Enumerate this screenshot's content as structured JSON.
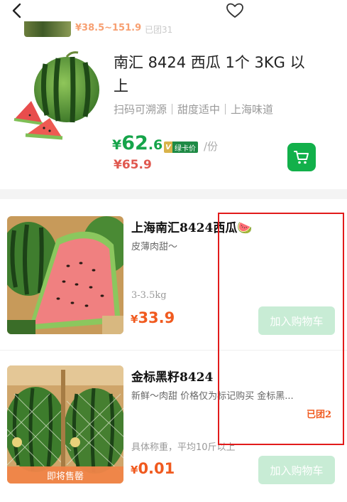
{
  "header": {
    "back_icon": "chevron-left-icon",
    "favorite_icon": "heart-outline-icon"
  },
  "partial_item": {
    "price_text": "¥38.5~151.9",
    "group_text": "已团31"
  },
  "featured_product": {
    "title": "南汇 8424 西瓜 1个 3KG 以上",
    "tags": "扫码可溯源｜甜度适中｜上海味道",
    "price_currency": "¥",
    "price_int": "62",
    "price_dec": ".6",
    "vip_letter": "V",
    "vip_label": "绿卡价",
    "unit": "/份",
    "original_price": "¥65.9",
    "cart_icon": "shopping-cart-icon"
  },
  "products": [
    {
      "title": "上海南汇8424西瓜",
      "emoji": "🍉",
      "subtitle": "皮薄肉甜～",
      "spec": "3-3.5kg",
      "price_currency": "¥",
      "price": "33.9",
      "add_label": "加入购物车"
    },
    {
      "title": "金标黑籽8424",
      "subtitle": "新鲜～肉甜 价格仅为标记购买 金标黑...",
      "group_count": "已团2",
      "spec": "具体称重，平均10斤以上",
      "price_currency": "¥",
      "price": "0.01",
      "add_label": "加入购物车",
      "banner": "即将售罄"
    }
  ],
  "colors": {
    "accent_green": "#16a44a",
    "price_orange": "#f05a1f",
    "original_red": "#e0584f",
    "annotation_red": "#e21b1b"
  }
}
